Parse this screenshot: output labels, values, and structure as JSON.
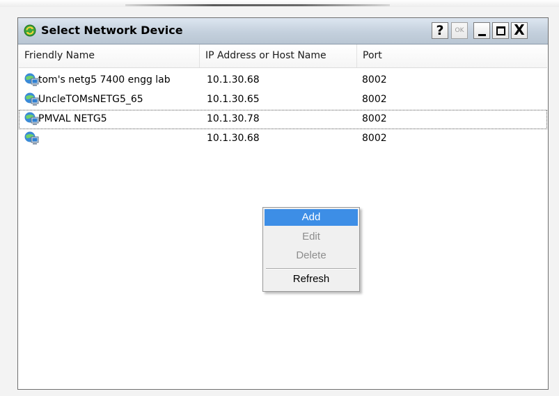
{
  "window": {
    "title": "Select Network Device",
    "buttons": {
      "help": "?",
      "ok": "OK",
      "close": "X"
    }
  },
  "table": {
    "columns": [
      "Friendly Name",
      "IP Address or Host Name",
      "Port"
    ],
    "rows": [
      {
        "name": "tom's netg5 7400 engg lab",
        "ip": "10.1.30.68",
        "port": "8002"
      },
      {
        "name": "UncleTOMsNETG5_65",
        "ip": "10.1.30.65",
        "port": "8002"
      },
      {
        "name": "PMVAL NETG5",
        "ip": "10.1.30.78",
        "port": "8002"
      },
      {
        "name": "",
        "ip": "10.1.30.68",
        "port": "8002"
      }
    ],
    "selected_row": 2,
    "row_icon": "network-computer-icon"
  },
  "context_menu": {
    "items": [
      {
        "label": "Add",
        "state": "highlighted"
      },
      {
        "label": "Edit",
        "state": "disabled"
      },
      {
        "label": "Delete",
        "state": "disabled"
      },
      {
        "label": "Refresh",
        "state": "enabled"
      }
    ],
    "highlight_color": "#3d8ee6"
  },
  "colors": {
    "titlebar": "#c4d0dd",
    "menu_bg": "#f0f0f0"
  }
}
